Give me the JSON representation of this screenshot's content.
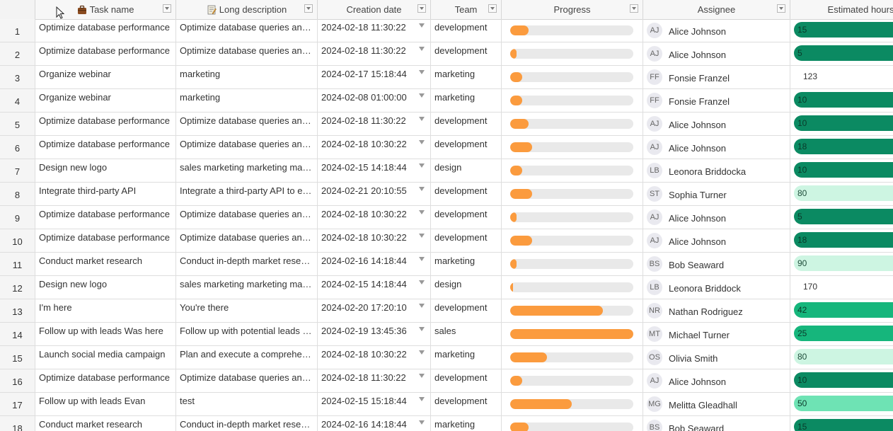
{
  "columns": [
    {
      "key": "rownum",
      "label": ""
    },
    {
      "key": "task",
      "label": "Task name",
      "icon": "briefcase-icon"
    },
    {
      "key": "desc",
      "label": "Long description",
      "icon": "memo-icon"
    },
    {
      "key": "date",
      "label": "Creation date"
    },
    {
      "key": "team",
      "label": "Team"
    },
    {
      "key": "progress",
      "label": "Progress"
    },
    {
      "key": "assignee",
      "label": "Assignee"
    },
    {
      "key": "hours",
      "label": "Estimated hours"
    }
  ],
  "colors": {
    "progress": "#fb9b3e",
    "hours_dark": "#0b8a62",
    "hours_mid": "#16b67c",
    "hours_light": "#cdf5e2",
    "hours_light2": "#6ee3b4"
  },
  "rows": [
    {
      "n": "1",
      "task": "Optimize database performance",
      "desc": "Optimize database queries and…",
      "date": "2024-02-18 11:30:22",
      "team": "development",
      "progress": 0.15,
      "initials": "AJ",
      "assignee": "Alice Johnson",
      "hours": "15",
      "hours_style": "dark"
    },
    {
      "n": "2",
      "task": "Optimize database performance",
      "desc": "Optimize database queries and…",
      "date": "2024-02-18 11:30:22",
      "team": "development",
      "progress": 0.05,
      "initials": "AJ",
      "assignee": "Alice Johnson",
      "hours": "5",
      "hours_style": "dark"
    },
    {
      "n": "3",
      "task": "Organize webinar",
      "desc": "marketing",
      "date": "2024-02-17 15:18:44",
      "team": "marketing",
      "progress": 0.1,
      "initials": "FF",
      "assignee": "Fonsie Franzel",
      "hours": "123",
      "hours_style": "none"
    },
    {
      "n": "4",
      "task": "Organize webinar",
      "desc": "marketing",
      "date": "2024-02-08 01:00:00",
      "team": "marketing",
      "progress": 0.1,
      "initials": "FF",
      "assignee": "Fonsie Franzel",
      "hours": "10",
      "hours_style": "dark"
    },
    {
      "n": "5",
      "task": "Optimize database performance",
      "desc": "Optimize database queries and…",
      "date": "2024-02-18 11:30:22",
      "team": "development",
      "progress": 0.15,
      "initials": "AJ",
      "assignee": "Alice Johnson",
      "hours": "10",
      "hours_style": "dark"
    },
    {
      "n": "6",
      "task": "Optimize database performance",
      "desc": "Optimize database queries and…",
      "date": "2024-02-18 10:30:22",
      "team": "development",
      "progress": 0.18,
      "initials": "AJ",
      "assignee": "Alice Johnson",
      "hours": "18",
      "hours_style": "dark"
    },
    {
      "n": "7",
      "task": "Design new logo",
      "desc": "sales marketing marketing mar…",
      "date": "2024-02-15 14:18:44",
      "team": "design",
      "progress": 0.1,
      "initials": "LB",
      "assignee": "Leonora Briddocka",
      "hours": "10",
      "hours_style": "dark"
    },
    {
      "n": "8",
      "task": "Integrate third-party API",
      "desc": "Integrate a third-party API to e…",
      "date": "2024-02-21 20:10:55",
      "team": "development",
      "progress": 0.18,
      "initials": "ST",
      "assignee": "Sophia Turner",
      "hours": "80",
      "hours_style": "light"
    },
    {
      "n": "9",
      "task": "Optimize database performance",
      "desc": "Optimize database queries and…",
      "date": "2024-02-18 10:30:22",
      "team": "development",
      "progress": 0.05,
      "initials": "AJ",
      "assignee": "Alice Johnson",
      "hours": "5",
      "hours_style": "dark"
    },
    {
      "n": "10",
      "task": "Optimize database performance",
      "desc": "Optimize database queries and…",
      "date": "2024-02-18 10:30:22",
      "team": "development",
      "progress": 0.18,
      "initials": "AJ",
      "assignee": "Alice Johnson",
      "hours": "18",
      "hours_style": "dark"
    },
    {
      "n": "11",
      "task": "Conduct market research",
      "desc": "Conduct in-depth market resea…",
      "date": "2024-02-16 14:18:44",
      "team": "marketing",
      "progress": 0.05,
      "initials": "BS",
      "assignee": "Bob Seaward",
      "hours": "90",
      "hours_style": "light"
    },
    {
      "n": "12",
      "task": "Design new logo",
      "desc": "sales marketing marketing mar…",
      "date": "2024-02-15 14:18:44",
      "team": "design",
      "progress": 0.02,
      "initials": "LB",
      "assignee": "Leonora Briddock",
      "hours": "170",
      "hours_style": "none"
    },
    {
      "n": "13",
      "task": "I'm here",
      "desc": "You're there",
      "date": "2024-02-20 17:20:10",
      "team": "development",
      "progress": 0.75,
      "initials": "NR",
      "assignee": "Nathan Rodriguez",
      "hours": "42",
      "hours_style": "mid"
    },
    {
      "n": "14",
      "task": "Follow up with leads Was here",
      "desc": "Follow up with potential leads t…",
      "date": "2024-02-19 13:45:36",
      "team": "sales",
      "progress": 1.0,
      "initials": "MT",
      "assignee": "Michael Turner",
      "hours": "25",
      "hours_style": "mid"
    },
    {
      "n": "15",
      "task": "Launch social media campaign",
      "desc": "Plan and execute a comprehen…",
      "date": "2024-02-18 10:30:22",
      "team": "marketing",
      "progress": 0.3,
      "initials": "OS",
      "assignee": "Olivia Smith",
      "hours": "80",
      "hours_style": "light"
    },
    {
      "n": "16",
      "task": "Optimize database performance",
      "desc": "Optimize database queries and…",
      "date": "2024-02-18 11:30:22",
      "team": "development",
      "progress": 0.1,
      "initials": "AJ",
      "assignee": "Alice Johnson",
      "hours": "10",
      "hours_style": "dark"
    },
    {
      "n": "17",
      "task": "Follow up with leads Evan",
      "desc": "test",
      "date": "2024-02-15 15:18:44",
      "team": "development",
      "progress": 0.5,
      "initials": "MG",
      "assignee": "Melitta Gleadhall",
      "hours": "50",
      "hours_style": "light2"
    },
    {
      "n": "18",
      "task": "Conduct market research",
      "desc": "Conduct in-depth market resea…",
      "date": "2024-02-16 14:18:44",
      "team": "marketing",
      "progress": 0.15,
      "initials": "BS",
      "assignee": "Bob Seaward",
      "hours": "15",
      "hours_style": "dark"
    }
  ]
}
